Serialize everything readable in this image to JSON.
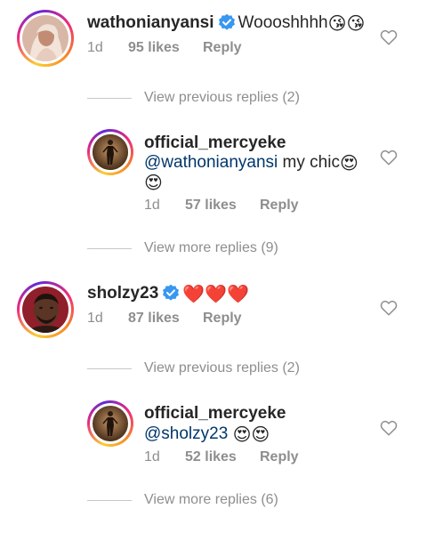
{
  "threads": [
    {
      "comment": {
        "username": "wathonianyansi",
        "verified": true,
        "text": "Woooshhhh",
        "emojis": "😘😘",
        "age": "1d",
        "likes": "95 likes",
        "reply": "Reply"
      },
      "previous_replies": "View previous replies (2)",
      "reply": {
        "username": "official_mercyeke",
        "mention": "@wathonianyansi",
        "text": " my chic",
        "emojis": "😍",
        "emojis_line2": "😍",
        "age": "1d",
        "likes": "57 likes",
        "reply": "Reply"
      },
      "more_replies": "View more replies (9)"
    },
    {
      "comment": {
        "username": "sholzy23",
        "verified": true,
        "text": "",
        "emojis": "❤️❤️❤️",
        "age": "1d",
        "likes": "87 likes",
        "reply": "Reply"
      },
      "previous_replies": "View previous replies (2)",
      "reply": {
        "username": "official_mercyeke",
        "mention": "@sholzy23",
        "text": " ",
        "emojis": "😍😍",
        "age": "1d",
        "likes": "52 likes",
        "reply": "Reply"
      },
      "more_replies": "View more replies (6)"
    }
  ],
  "colors": {
    "text": "#262626",
    "secondary": "#8e8e8e",
    "mention": "#00376b",
    "verified": "#3897f0"
  },
  "icons": [
    "verified-badge-icon",
    "heart-outline-icon",
    "avatar-image"
  ]
}
